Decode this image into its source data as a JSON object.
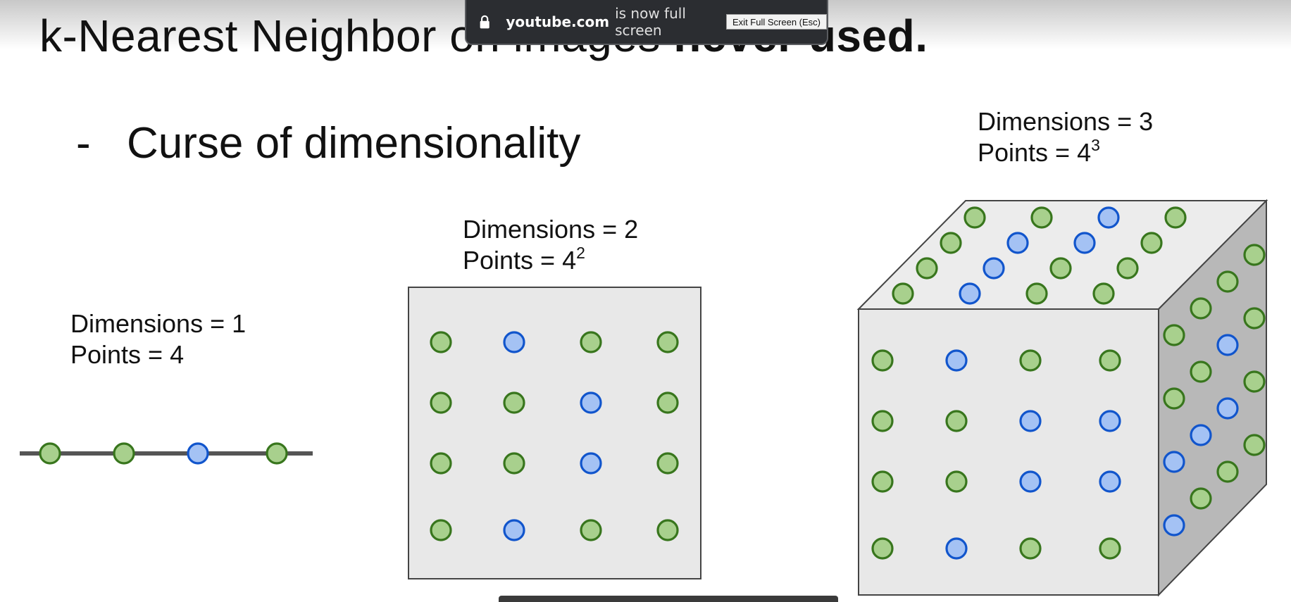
{
  "title": {
    "part1": "k-Nearest Neighbor on images",
    "part2": "never used."
  },
  "bullet": {
    "dash": "-",
    "text": "Curse of dimensionality"
  },
  "figure_1d": {
    "dimensions_label": "Dimensions = 1",
    "points_label": "Points = 4",
    "points": [
      "green",
      "green",
      "blue",
      "green"
    ]
  },
  "figure_2d": {
    "dimensions_label": "Dimensions = 2",
    "points_label": "Points = 4",
    "points_exponent": "2",
    "grid": [
      [
        "green",
        "blue",
        "green",
        "green"
      ],
      [
        "green",
        "green",
        "blue",
        "green"
      ],
      [
        "green",
        "green",
        "blue",
        "green"
      ],
      [
        "green",
        "blue",
        "green",
        "green"
      ]
    ]
  },
  "figure_3d": {
    "dimensions_label": "Dimensions = 3",
    "points_label": "Points = 4",
    "points_exponent": "3",
    "front_grid": [
      [
        "green",
        "blue",
        "green",
        "green"
      ],
      [
        "green",
        "green",
        "blue",
        "blue"
      ],
      [
        "green",
        "green",
        "blue",
        "blue"
      ],
      [
        "green",
        "blue",
        "green",
        "green"
      ]
    ],
    "top_grid": [
      [
        "green",
        "green",
        "blue",
        "green"
      ],
      [
        "green",
        "blue",
        "blue",
        "green"
      ],
      [
        "green",
        "blue",
        "green",
        "green"
      ],
      [
        "green",
        "blue",
        "green",
        "green"
      ]
    ],
    "side_grid": [
      [
        "green",
        "green",
        "green",
        "green"
      ],
      [
        "green",
        "green",
        "blue",
        "green"
      ],
      [
        "blue",
        "blue",
        "blue",
        "green"
      ],
      [
        "blue",
        "green",
        "green",
        "green"
      ]
    ]
  },
  "colors": {
    "green_fill": "#a8d08d",
    "green_stroke": "#38761d",
    "blue_fill": "#a4c2f4",
    "blue_stroke": "#1155cc",
    "face_front": "#e8e8e8",
    "face_top": "#ececec",
    "face_side": "#b8b8b8",
    "line": "#555555"
  },
  "fullscreen_notice": {
    "domain": "youtube.com",
    "message": "is now full screen",
    "exit_button": "Exit Full Screen (Esc)"
  }
}
